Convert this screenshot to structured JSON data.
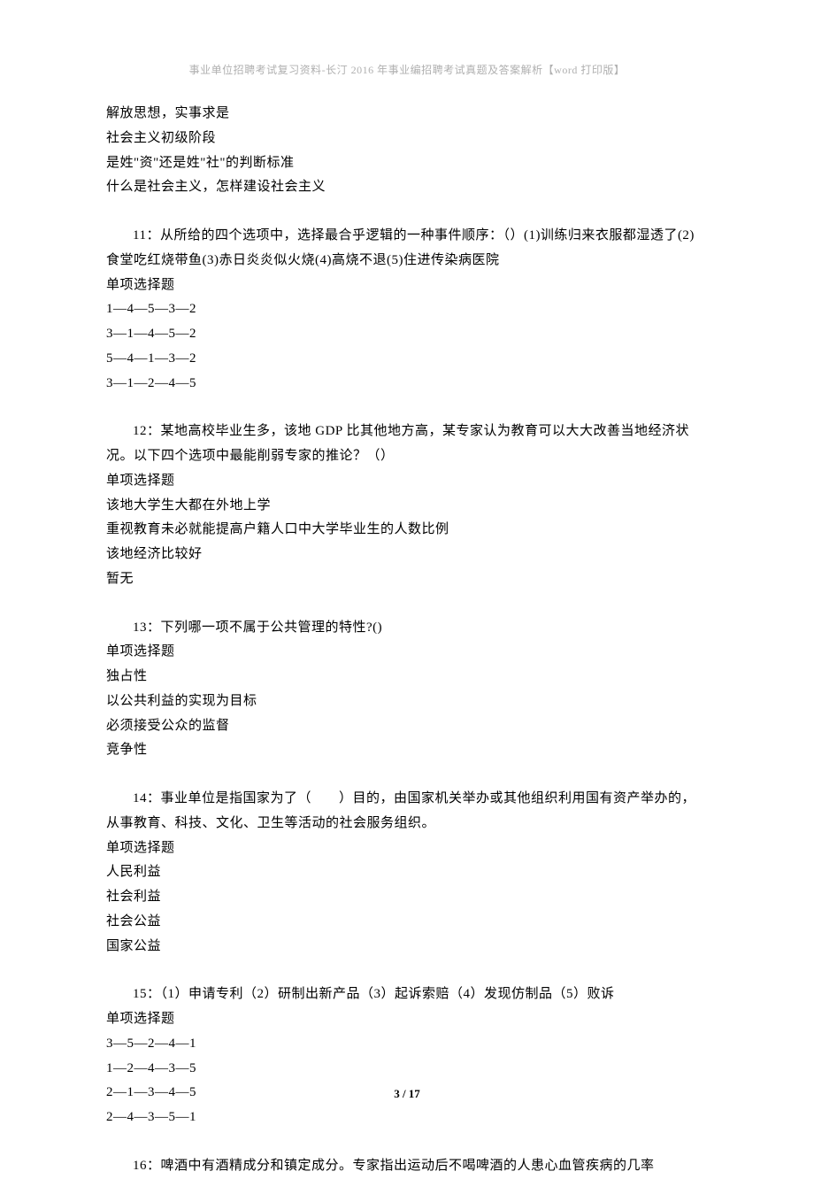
{
  "header": "事业单位招聘考试复习资料-长汀 2016 年事业编招聘考试真题及答案解析【word 打印版】",
  "footer": "3 / 17",
  "q10": {
    "opts": [
      "解放思想，实事求是",
      "社会主义初级阶段",
      "是姓\"资\"还是姓\"社\"的判断标准",
      "什么是社会主义，怎样建设社会主义"
    ]
  },
  "q11": {
    "stem": "11：从所给的四个选项中，选择最合乎逻辑的一种事件顺序：（）(1)训练归来衣服都湿透了(2)食堂吃红烧带鱼(3)赤日炎炎似火烧(4)高烧不退(5)住进传染病医院",
    "type": "单项选择题",
    "opts": [
      "1—4—5—3—2",
      "3—1—4—5—2",
      "5—4—1—3—2",
      "3—1—2—4—5"
    ]
  },
  "q12": {
    "stem": "12：某地高校毕业生多，该地 GDP 比其他地方高，某专家认为教育可以大大改善当地经济状况。以下四个选项中最能削弱专家的推论？（）",
    "type": "单项选择题",
    "opts": [
      "该地大学生大都在外地上学",
      "重视教育未必就能提高户籍人口中大学毕业生的人数比例",
      "该地经济比较好",
      "暂无"
    ]
  },
  "q13": {
    "stem": "13：下列哪一项不属于公共管理的特性?()",
    "type": "单项选择题",
    "opts": [
      "独占性",
      "以公共利益的实现为目标",
      "必须接受公众的监督",
      "竞争性"
    ]
  },
  "q14": {
    "stem": "14：事业单位是指国家为了（　　）目的，由国家机关举办或其他组织利用国有资产举办的，从事教育、科技、文化、卫生等活动的社会服务组织。",
    "type": "单项选择题",
    "opts": [
      "人民利益",
      "社会利益",
      "社会公益",
      "国家公益"
    ]
  },
  "q15": {
    "stem": "15：（1）申请专利（2）研制出新产品（3）起诉索赔（4）发现仿制品（5）败诉",
    "type": "单项选择题",
    "opts": [
      "3—5—2—4—1",
      "1—2—4—3—5",
      "2—1—3—4—5",
      "2—4—3—5—1"
    ]
  },
  "q16": {
    "stem": "16：啤酒中有酒精成分和镇定成分。专家指出运动后不喝啤酒的人患心血管疾病的几率"
  }
}
